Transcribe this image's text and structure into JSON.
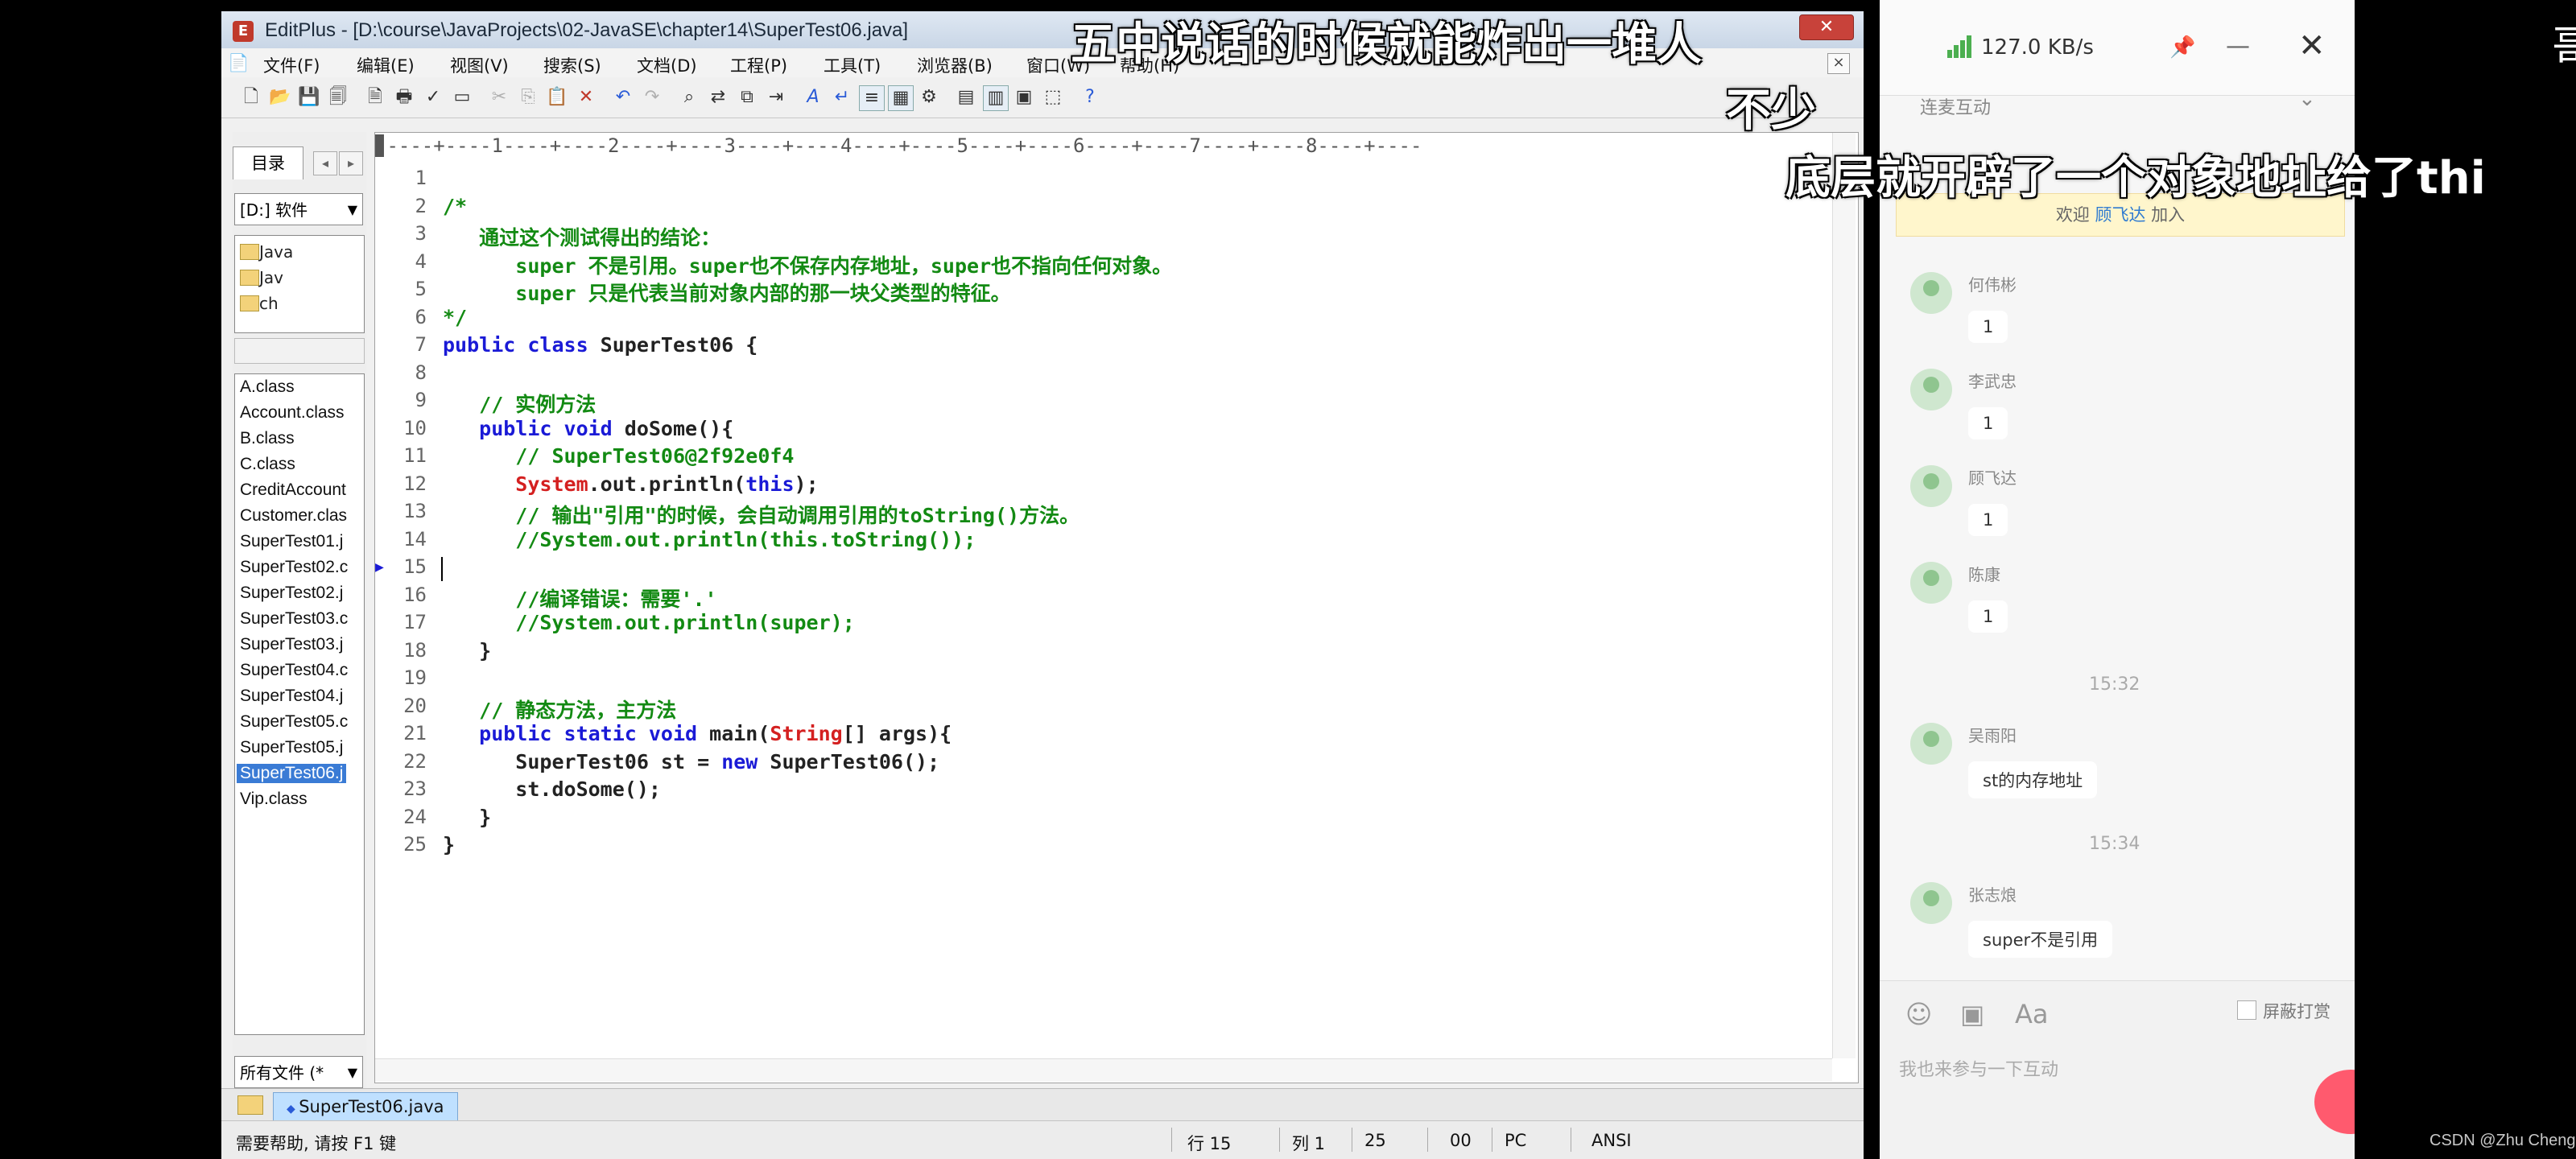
{
  "editplus": {
    "title": "EditPlus - [D:\\course\\JavaProjects\\02-JavaSE\\chapter14\\SuperTest06.java]",
    "close_glyph": "✕",
    "menu": [
      "文件(F)",
      "编辑(E)",
      "视图(V)",
      "搜索(S)",
      "文档(D)",
      "工程(P)",
      "工具(T)",
      "浏览器(B)",
      "窗口(W)",
      "帮助(H)"
    ],
    "menu_close_glyph": "×",
    "directory": {
      "tab_label": "目录",
      "drive": "[D:] 软件",
      "tree": [
        "Java",
        "Jav",
        "ch"
      ],
      "files": [
        "A.class",
        "Account.class",
        "B.class",
        "C.class",
        "CreditAccount",
        "Customer.clas",
        "SuperTest01.j",
        "SuperTest02.c",
        "SuperTest02.j",
        "SuperTest03.c",
        "SuperTest03.j",
        "SuperTest04.c",
        "SuperTest04.j",
        "SuperTest05.c",
        "SuperTest05.j",
        "SuperTest06.j",
        "Vip.class"
      ],
      "selected_file": "SuperTest06.j",
      "filter": "所有文件 (*"
    },
    "ruler": "▊----+----1----+----2----+----3----+----4----+----5----+----6----+----7----+----8----+----",
    "code_lines": [
      {
        "n": "1",
        "parts": []
      },
      {
        "n": "2",
        "parts": [
          {
            "t": "/*",
            "c": "c"
          }
        ]
      },
      {
        "n": "3",
        "parts": [
          {
            "t": "   通过这个测试得出的结论：",
            "c": "c"
          }
        ]
      },
      {
        "n": "4",
        "parts": [
          {
            "t": "      super 不是引用。super也不保存内存地址，super也不指向任何对象。",
            "c": "c"
          }
        ]
      },
      {
        "n": "5",
        "parts": [
          {
            "t": "      super 只是代表当前对象内部的那一块父类型的特征。",
            "c": "c"
          }
        ]
      },
      {
        "n": "6",
        "parts": [
          {
            "t": "*/",
            "c": "c"
          }
        ]
      },
      {
        "n": "7",
        "parts": [
          {
            "t": "public class ",
            "c": "k"
          },
          {
            "t": "SuperTest06 {",
            "c": "t"
          }
        ]
      },
      {
        "n": "8",
        "parts": []
      },
      {
        "n": "9",
        "parts": [
          {
            "t": "   // 实例方法",
            "c": "c"
          }
        ]
      },
      {
        "n": "10",
        "parts": [
          {
            "t": "   public void ",
            "c": "k"
          },
          {
            "t": "doSome(){",
            "c": "t"
          }
        ]
      },
      {
        "n": "11",
        "parts": [
          {
            "t": "      // SuperTest06@2f92e0f4",
            "c": "c"
          }
        ]
      },
      {
        "n": "12",
        "parts": [
          {
            "t": "      System",
            "c": "s"
          },
          {
            "t": ".out.println(",
            "c": "t"
          },
          {
            "t": "this",
            "c": "k"
          },
          {
            "t": ");",
            "c": "t"
          }
        ]
      },
      {
        "n": "13",
        "parts": [
          {
            "t": "      // 输出\"引用\"的时候，会自动调用引用的toString()方法。",
            "c": "c"
          }
        ]
      },
      {
        "n": "14",
        "parts": [
          {
            "t": "      //System.out.println(this.toString());",
            "c": "c"
          }
        ]
      },
      {
        "n": "15",
        "parts": []
      },
      {
        "n": "16",
        "parts": [
          {
            "t": "      //编译错误：需要'.'",
            "c": "c"
          }
        ]
      },
      {
        "n": "17",
        "parts": [
          {
            "t": "      //System.out.println(super);",
            "c": "c"
          }
        ]
      },
      {
        "n": "18",
        "parts": [
          {
            "t": "   }",
            "c": "t"
          }
        ]
      },
      {
        "n": "19",
        "parts": []
      },
      {
        "n": "20",
        "parts": [
          {
            "t": "   // 静态方法，主方法",
            "c": "c"
          }
        ]
      },
      {
        "n": "21",
        "parts": [
          {
            "t": "   public static void ",
            "c": "k"
          },
          {
            "t": "main(",
            "c": "t"
          },
          {
            "t": "String",
            "c": "s"
          },
          {
            "t": "[] args){",
            "c": "t"
          }
        ]
      },
      {
        "n": "22",
        "parts": [
          {
            "t": "      SuperTest06 st = ",
            "c": "t"
          },
          {
            "t": "new ",
            "c": "k"
          },
          {
            "t": "SuperTest06();",
            "c": "t"
          }
        ]
      },
      {
        "n": "23",
        "parts": [
          {
            "t": "      st.doSome();",
            "c": "t"
          }
        ]
      },
      {
        "n": "24",
        "parts": [
          {
            "t": "   }",
            "c": "t"
          }
        ]
      },
      {
        "n": "25",
        "parts": [
          {
            "t": "}",
            "c": "t"
          }
        ]
      }
    ],
    "document_tab": "SuperTest06.java",
    "status": {
      "help": "需要帮助, 请按 F1 键",
      "line": "行 15",
      "col": "列 1",
      "num": "25",
      "hex": "00",
      "mode": "PC",
      "encoding": "ANSI"
    }
  },
  "chat": {
    "net_speed": "127.0 KB/s",
    "close_glyph": "✕",
    "min_glyph": "—",
    "pin_glyph": "📌",
    "tab": "连麦互动",
    "welcome_prefix": "欢迎 ",
    "welcome_name": "顾飞达",
    "welcome_suffix": " 加入",
    "messages": [
      {
        "name": "何伟彬",
        "text": "1"
      },
      {
        "name": "李武忠",
        "text": "1"
      },
      {
        "name": "顾飞达",
        "text": "1"
      },
      {
        "name": "陈康",
        "text": "1"
      },
      {
        "name": "吴雨阳",
        "text": "st的内存地址"
      },
      {
        "name": "张志烺",
        "text": "super不是引用"
      }
    ],
    "times": [
      "15:32",
      "15:34"
    ],
    "ignore_label": "屏蔽打赏",
    "input_placeholder": "我也来参与一下互动"
  },
  "subtitles": {
    "line1": "五中说话的时候就能炸出一堆人",
    "line2": "不少",
    "line3": "底层就开辟了一个对象地址给了thi"
  },
  "edge_char": "哥",
  "watermark": "CSDN @Zhu Cheng"
}
